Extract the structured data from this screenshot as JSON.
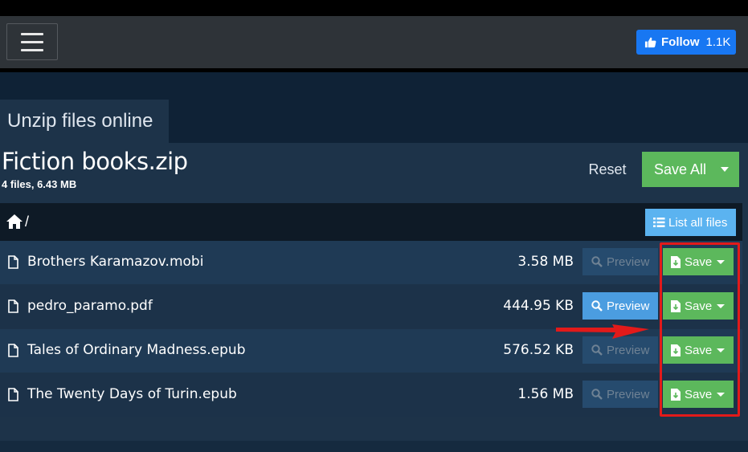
{
  "header": {
    "follow_label": "Follow",
    "follow_count": "1.1K",
    "brand_color": "#1877f2"
  },
  "tab": {
    "title": "Unzip files online"
  },
  "archive": {
    "name": "Fiction books.zip",
    "summary": "4 files, 6.43 MB",
    "reset_label": "Reset",
    "save_all_label": "Save All"
  },
  "path": {
    "current": "/",
    "list_all_label": "List all files"
  },
  "files": [
    {
      "name": "Brothers Karamazov.mobi",
      "size": "3.58 MB",
      "preview_label": "Preview",
      "preview_enabled": false,
      "save_label": "Save"
    },
    {
      "name": "pedro_paramo.pdf",
      "size": "444.95 KB",
      "preview_label": "Preview",
      "preview_enabled": true,
      "save_label": "Save"
    },
    {
      "name": "Tales of Ordinary Madness.epub",
      "size": "576.52 KB",
      "preview_label": "Preview",
      "preview_enabled": false,
      "save_label": "Save"
    },
    {
      "name": "The Twenty Days of Turin.epub",
      "size": "1.56 MB",
      "preview_label": "Preview",
      "preview_enabled": false,
      "save_label": "Save"
    }
  ],
  "colors": {
    "save_green": "#5cb85c",
    "preview_blue": "#4b9de0",
    "annotation_red": "#e21a1a"
  }
}
